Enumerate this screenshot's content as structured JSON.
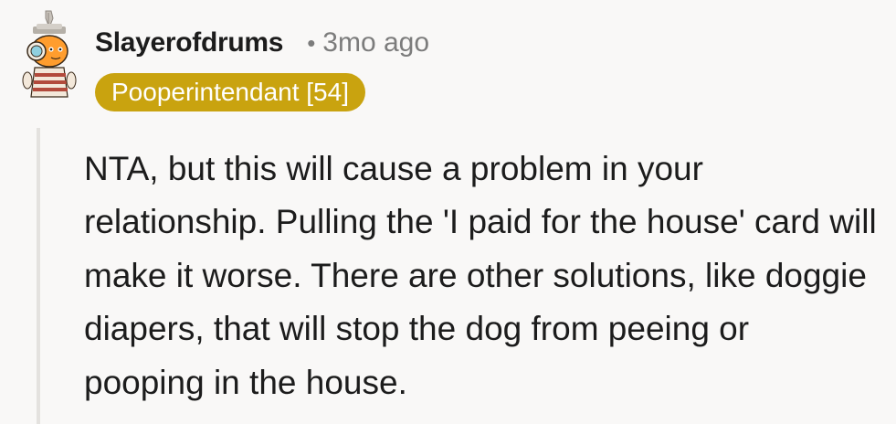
{
  "comment": {
    "author": "Slayerofdrums",
    "separator": "•",
    "timestamp": "3mo ago",
    "flair": "Pooperintendant [54]",
    "body": "NTA, but this will cause a problem in your relationship. Pulling the 'I paid for the house' card will make it worse. There are other solutions, like doggie diapers, that will stop the dog from peeing or pooping in the house."
  },
  "icons": {
    "avatar": "snoo-avatar-icon"
  },
  "colors": {
    "background": "#f9f8f7",
    "text": "#1c1c1c",
    "muted": "#7c7c7c",
    "flair_background": "#c9a30f",
    "flair_text": "#ffffff",
    "thread_line": "#e4e2df"
  }
}
